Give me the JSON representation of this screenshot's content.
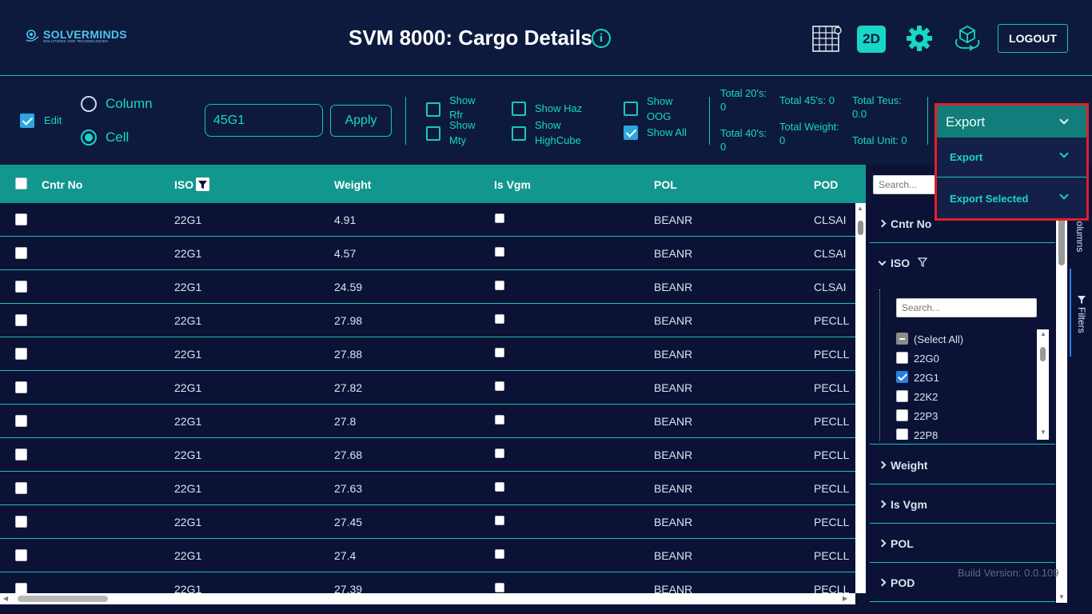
{
  "header": {
    "logo_main": "SOLVERMINDS",
    "logo_sub": "SOLUTIONS AND TECHNOLOGIES",
    "title": "SVM 8000: Cargo Details",
    "info_icon": "info-icon",
    "icons": [
      "grid-view-icon",
      "2d-view-icon",
      "gear-icon",
      "3d-cube-icon"
    ],
    "view_2d_label": "2D",
    "logout_label": "LOGOUT"
  },
  "toolbar": {
    "edit_label": "Edit",
    "edit_checked": true,
    "mode_options": [
      "Column",
      "Cell"
    ],
    "mode_selected": "Cell",
    "iso_value": "45G1",
    "apply_label": "Apply",
    "show_rfr": "Show Rfr",
    "show_rfr_a": "Show",
    "show_rfr_b": "Rfr",
    "show_mty_a": "Show",
    "show_mty_b": "Mty",
    "show_haz": "Show Haz",
    "show_highcube_a": "Show",
    "show_highcube_b": "HighCube",
    "show_oog_a": "Show",
    "show_oog_b": "OOG",
    "show_all": "Show All",
    "show_all_checked": true
  },
  "stats": {
    "total20_label": "Total 20's:",
    "total20_value": "0",
    "total40_label": "Total 40's:",
    "total40_value": "0",
    "total45": "Total 45's: 0",
    "total_weight_label": "Total Weight:",
    "total_weight_value": "0",
    "total_teus_label": "Total Teus:",
    "total_teus_value": "0.0",
    "total_unit": "Total Unit: 0"
  },
  "export": {
    "selected": "Export",
    "items": [
      "Export",
      "Export Selected"
    ]
  },
  "grid": {
    "columns": [
      "Cntr No",
      "ISO",
      "Weight",
      "Is Vgm",
      "POL",
      "POD"
    ],
    "rows": [
      {
        "iso": "22G1",
        "weight": "4.91",
        "pol": "BEANR",
        "pod": "CLSAI"
      },
      {
        "iso": "22G1",
        "weight": "4.57",
        "pol": "BEANR",
        "pod": "CLSAI"
      },
      {
        "iso": "22G1",
        "weight": "24.59",
        "pol": "BEANR",
        "pod": "CLSAI"
      },
      {
        "iso": "22G1",
        "weight": "27.98",
        "pol": "BEANR",
        "pod": "PECLL"
      },
      {
        "iso": "22G1",
        "weight": "27.88",
        "pol": "BEANR",
        "pod": "PECLL"
      },
      {
        "iso": "22G1",
        "weight": "27.82",
        "pol": "BEANR",
        "pod": "PECLL"
      },
      {
        "iso": "22G1",
        "weight": "27.8",
        "pol": "BEANR",
        "pod": "PECLL"
      },
      {
        "iso": "22G1",
        "weight": "27.68",
        "pol": "BEANR",
        "pod": "PECLL"
      },
      {
        "iso": "22G1",
        "weight": "27.63",
        "pol": "BEANR",
        "pod": "PECLL"
      },
      {
        "iso": "22G1",
        "weight": "27.45",
        "pol": "BEANR",
        "pod": "PECLL"
      },
      {
        "iso": "22G1",
        "weight": "27.4",
        "pol": "BEANR",
        "pod": "PECLL"
      },
      {
        "iso": "22G1",
        "weight": "27.39",
        "pol": "BEANR",
        "pod": "PECLL"
      }
    ]
  },
  "filter_panel": {
    "search_placeholder": "Search...",
    "groups": [
      "Cntr No",
      "ISO",
      "Weight",
      "Is Vgm",
      "POL",
      "POD"
    ],
    "iso_search_placeholder": "Search...",
    "iso_values": [
      {
        "label": "(Select All)",
        "state": "partial"
      },
      {
        "label": "22G0",
        "state": "unchecked"
      },
      {
        "label": "22G1",
        "state": "checked"
      },
      {
        "label": "22K2",
        "state": "unchecked"
      },
      {
        "label": "22P3",
        "state": "unchecked"
      },
      {
        "label": "22P8",
        "state": "unchecked"
      }
    ],
    "tab_columns": "Columns",
    "tab_filters": "Filters"
  },
  "footer": {
    "build_version": "Build Version: 0.0.109"
  }
}
